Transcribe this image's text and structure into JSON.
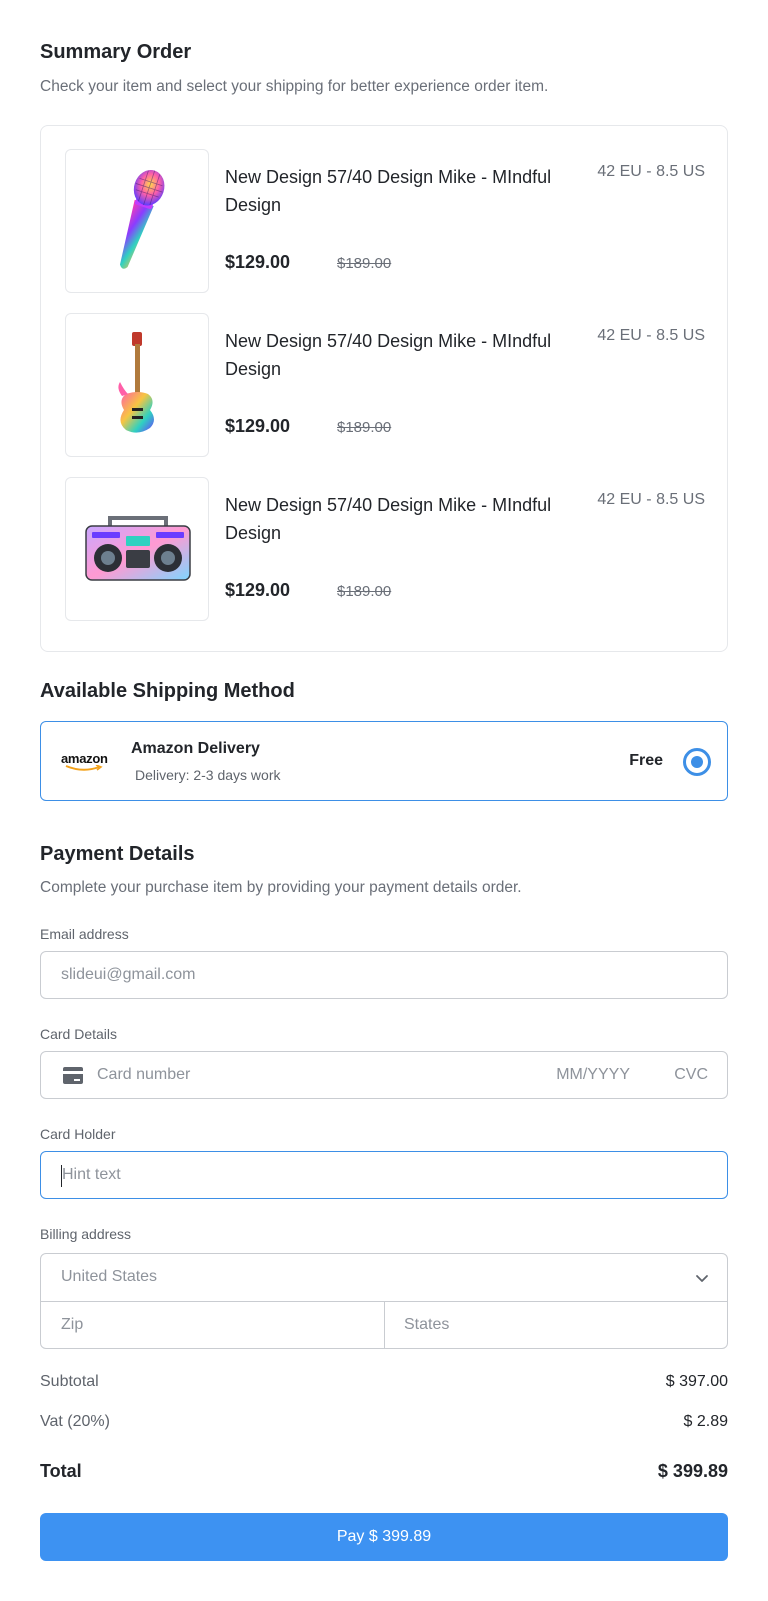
{
  "summary": {
    "title": "Summary Order",
    "subtitle": "Check your item and select your shipping for better experience order item."
  },
  "items": [
    {
      "image": "microphone",
      "name": "New Design 57/40 Design Mike - MIndful Design",
      "size": "42 EU - 8.5 US",
      "price": "$129.00",
      "old_price": "$189.00"
    },
    {
      "image": "electric-guitar",
      "name": "New Design 57/40 Design Mike - MIndful Design",
      "size": "42 EU - 8.5 US",
      "price": "$129.00",
      "old_price": "$189.00"
    },
    {
      "image": "boombox",
      "name": "New Design 57/40 Design Mike - MIndful Design",
      "size": "42 EU - 8.5 US",
      "price": "$129.00",
      "old_price": "$189.00"
    }
  ],
  "shipping": {
    "title": "Available Shipping Method",
    "method": {
      "logo_text": "amazon",
      "name": "Amazon Delivery",
      "desc": "Delivery: 2-3 days work",
      "price": "Free",
      "selected": true
    }
  },
  "payment": {
    "title": "Payment Details",
    "subtitle": "Complete your purchase item by providing your payment details order.",
    "email": {
      "label": "Email address",
      "placeholder": "slideui@gmail.com"
    },
    "card": {
      "label": "Card Details",
      "number_placeholder": "Card number",
      "expiry_placeholder": "MM/YYYY",
      "cvc_placeholder": "CVC",
      "icon": "credit-card-icon"
    },
    "holder": {
      "label": "Card Holder",
      "placeholder": "Hint text"
    },
    "billing": {
      "label": "Billing address",
      "country": "United States",
      "zip_placeholder": "Zip",
      "state_placeholder": "States"
    }
  },
  "totals": {
    "subtotal_label": "Subtotal",
    "subtotal_value": "$ 397.00",
    "vat_label": "Vat (20%)",
    "vat_value": "$ 2.89",
    "total_label": "Total",
    "total_value": "$ 399.89"
  },
  "pay_button": {
    "label": "Pay $ 399.89"
  },
  "colors": {
    "accent": "#3d92f2",
    "border": "#c9ccd1",
    "focus": "#3d8fe6"
  }
}
